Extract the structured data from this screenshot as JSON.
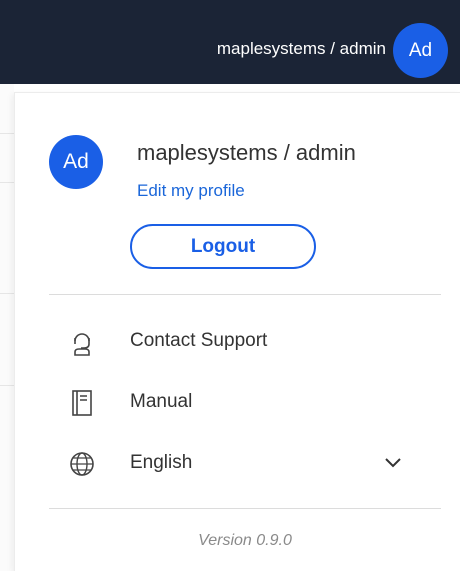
{
  "topbar": {
    "user_label": "maplesystems / admin",
    "avatar_initials": "Ad",
    "background": "#1b2436"
  },
  "profile": {
    "avatar_initials": "Ad",
    "name": "maplesystems / admin",
    "edit_link": "Edit my profile",
    "logout_label": "Logout",
    "accent": "#1a5fe6"
  },
  "menu": {
    "items": [
      {
        "label": "Contact Support",
        "icon": "headset-icon"
      },
      {
        "label": "Manual",
        "icon": "book-icon"
      },
      {
        "label": "English",
        "icon": "globe-icon"
      }
    ]
  },
  "language": {
    "selected": "English"
  },
  "footer": {
    "version": "Version 0.9.0"
  }
}
